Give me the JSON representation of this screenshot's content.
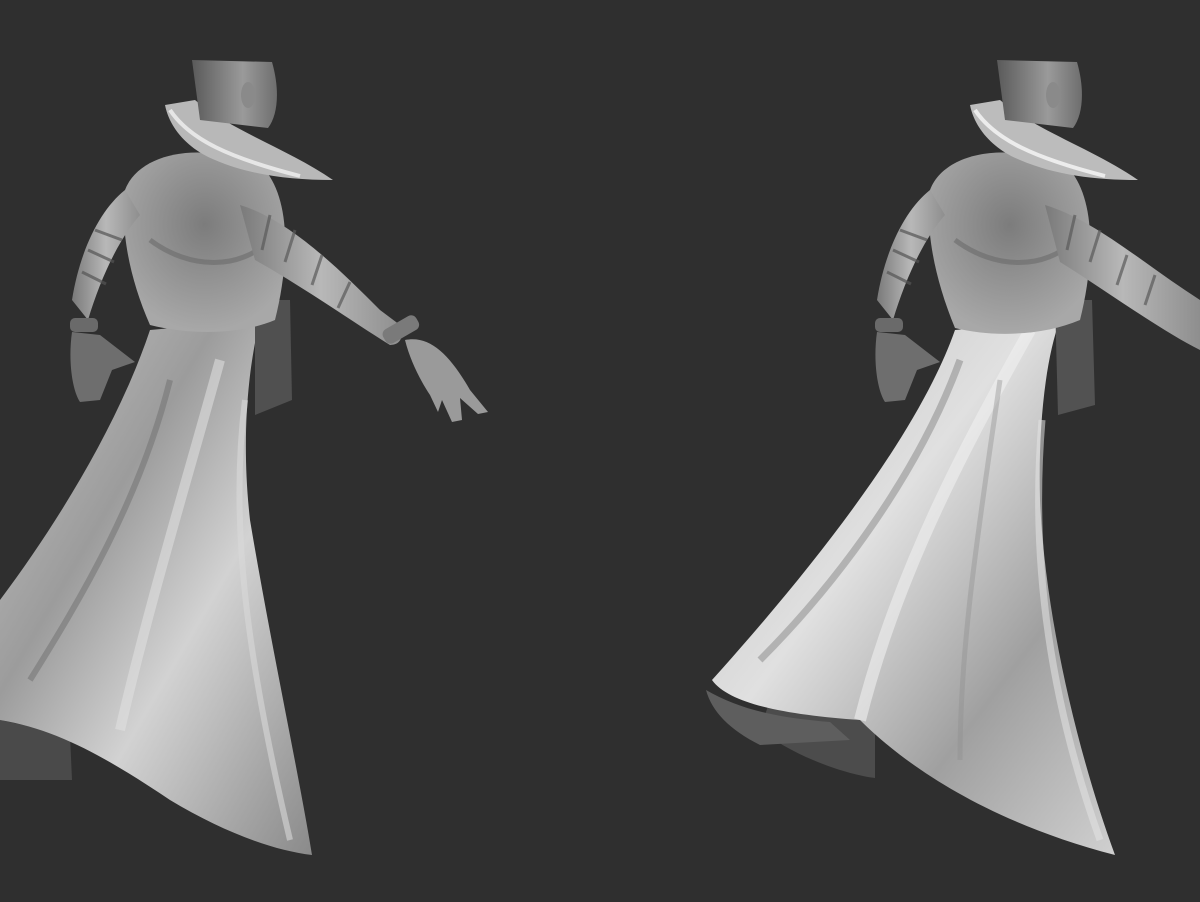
{
  "viewport": {
    "background_color": "#2f2f2f",
    "render_style": "matcap-grey-sculpt",
    "model_count": 2
  },
  "models": [
    {
      "name": "robed-figure-left",
      "shading": "grey-clay",
      "view": "three-quarter-back"
    },
    {
      "name": "robed-figure-right",
      "shading": "grey-clay",
      "view": "three-quarter-back"
    }
  ],
  "colors": {
    "cloth_light": "#d6d6d6",
    "cloth_mid": "#a9a9a9",
    "cloth_dark": "#5c5c5c",
    "skin_dark": "#6a6a6a"
  }
}
